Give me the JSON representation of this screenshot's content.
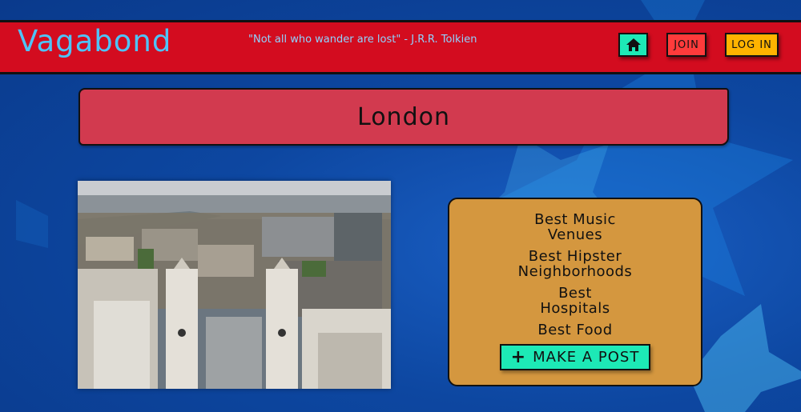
{
  "header": {
    "logo": "Vagabond",
    "quote": "\"Not all who wander are lost\" - J.R.R. Tolkien",
    "home_icon": "home-icon",
    "join_label": "JOIN",
    "login_label": "LOG IN"
  },
  "city": {
    "title": "London",
    "photo_description_icon": "london-skyline-photo"
  },
  "panel": {
    "links": [
      "Best Music Venues",
      "Best Hipster Neighborhoods",
      "Best Hospitals",
      "Best Food"
    ],
    "post_button_label": "MAKE A POST",
    "post_icon": "plus-icon"
  },
  "colors": {
    "header_bg": "#d30c1f",
    "logo": "#4fc3f7",
    "banner_bg": "#d23a4f",
    "panel_bg": "#d4973f",
    "accent_green": "#1de9b6",
    "join_red": "#ff3b3b",
    "login_orange": "#ffb300"
  }
}
